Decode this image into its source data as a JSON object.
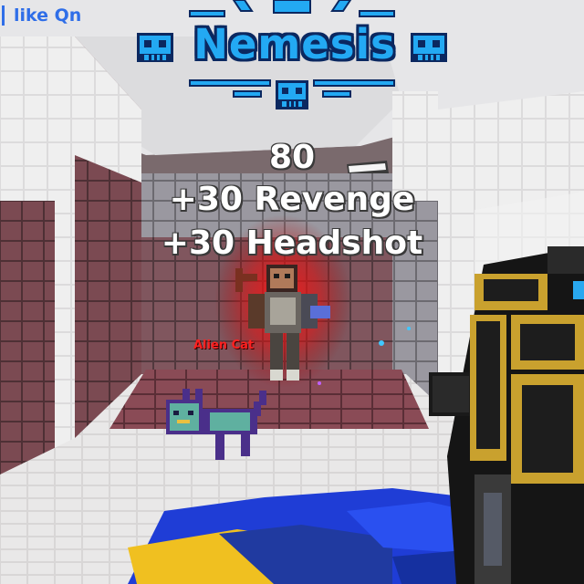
{
  "hud": {
    "kill_feed_text": "like Qn",
    "nemesis_label": "Nemesis",
    "score_points": "80",
    "bonus_revenge": "+30 Revenge",
    "bonus_headshot": "+30 Headshot",
    "enemy_name": "Alien Cat"
  },
  "icons": {
    "emblem": "skull-icon",
    "crosshair": "crosshair-icon",
    "weapon": "blocky-gold-gun",
    "pet": "alien-cat-pet"
  },
  "colors": {
    "kill_feed": "#2f6ee8",
    "nemesis_fill": "#23a9f3",
    "nemesis_outline": "#0b2860",
    "score_text": "#ffffff",
    "enemy_name": "#ff2020",
    "enemy_glow": "#e01010",
    "weapon_gold": "#c9a12e",
    "floor_blue": "#1f3dd6",
    "floor_yellow": "#f0c020"
  }
}
